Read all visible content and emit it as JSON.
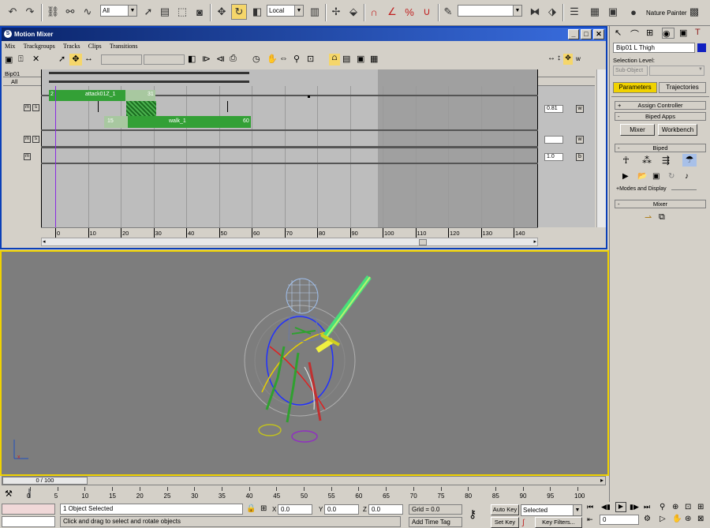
{
  "toolbar": {
    "filter_value": "All",
    "coord_value": "Local",
    "named_sel_value": "",
    "nature_painter": "Nature Painter",
    "icons": [
      "undo-icon",
      "redo-icon",
      "select-link-icon",
      "unlink-icon",
      "bind-space-warp-icon",
      "select-object-icon",
      "select-rect-region-icon",
      "select-by-name-icon",
      "window-crossing-icon",
      "move-icon",
      "rotate-icon",
      "scale-icon",
      "use-pivot-icon",
      "select-manipulate-icon",
      "snap-3d-icon",
      "angle-snap-icon",
      "percent-snap-icon",
      "spinner-snap-icon",
      "edit-named-selection-icon",
      "mirror-icon",
      "align-icon",
      "layer-manager-icon",
      "curve-editor-icon",
      "schematic-view-icon",
      "material-editor-icon",
      "render-scene-icon",
      "quick-render-icon"
    ]
  },
  "mixer": {
    "title": "Motion Mixer",
    "menu": [
      "Mix",
      "Trackgroups",
      "Tracks",
      "Clips",
      "Transitions"
    ],
    "toolbar_w": "w",
    "group_label": "Bip01",
    "track_all_label": "All",
    "clip1_label": "attack01Z_1",
    "clip1_start": "2",
    "clip1_end": "31",
    "clip2_label": "walk_1",
    "clip2_start": "15",
    "clip2_end": "60",
    "weight1": "0.81",
    "weight2": "",
    "weight3": "1.0",
    "w_label": "w",
    "b_label": "b",
    "m_label": "m",
    "s_label": "s",
    "ruler": [
      "0",
      "10",
      "20",
      "30",
      "40",
      "50",
      "60",
      "70",
      "80",
      "90",
      "100",
      "110",
      "120",
      "130",
      "140"
    ]
  },
  "panel": {
    "object_name": "Bip01 L Thigh",
    "selection_level": "Selection Level:",
    "sub_object": "Sub-Object",
    "tab_parameters": "Parameters",
    "tab_trajectories": "Trajectories",
    "assign_controller": "Assign Controller",
    "biped_apps": "Biped Apps",
    "mixer_btn": "Mixer",
    "workbench_btn": "Workbench",
    "biped": "Biped",
    "modes_display": "+Modes and Display",
    "mixer_rollout": "Mixer",
    "accent": "#f0d200"
  },
  "timeline": {
    "frame_counter": "0 / 100",
    "ticks": [
      "0",
      "5",
      "10",
      "15",
      "20",
      "25",
      "30",
      "35",
      "40",
      "45",
      "50",
      "55",
      "60",
      "65",
      "70",
      "75",
      "80",
      "85",
      "90",
      "95",
      "100"
    ]
  },
  "status": {
    "selected": "1 Object Selected",
    "prompt": "Click and drag to select and rotate objects",
    "x_label": "X",
    "x_value": "0.0",
    "y_label": "Y",
    "y_value": "0.0",
    "z_label": "Z",
    "z_value": "0.0",
    "grid": "Grid = 0.0",
    "add_time_tag": "Add Time Tag",
    "auto_key": "Auto Key",
    "set_key": "Set Key",
    "selected_dd": "Selected",
    "key_filters": "Key Filters...",
    "frame_value": "0"
  }
}
